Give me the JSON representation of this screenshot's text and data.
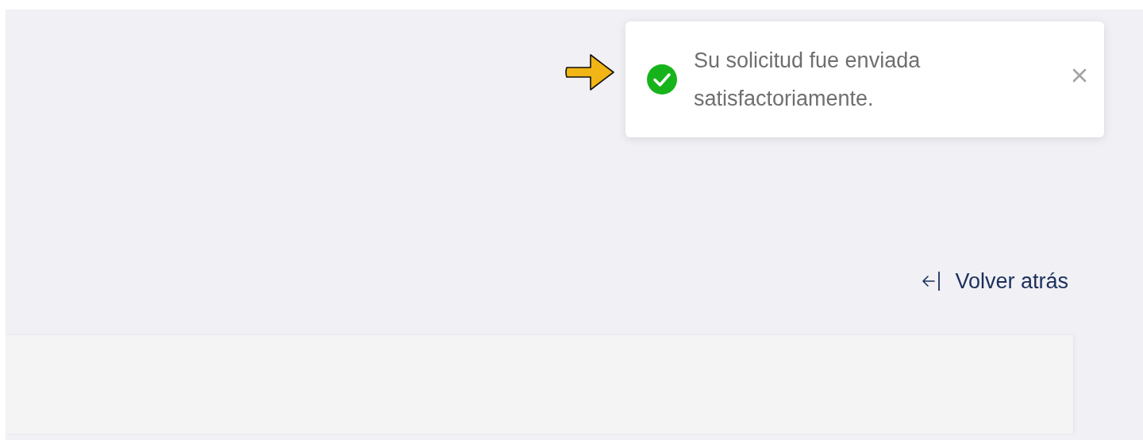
{
  "toast": {
    "kind": "success",
    "message": "Su solicitud fue enviada satisfactoriamente."
  },
  "back_link": {
    "label": "Volver atrás"
  }
}
